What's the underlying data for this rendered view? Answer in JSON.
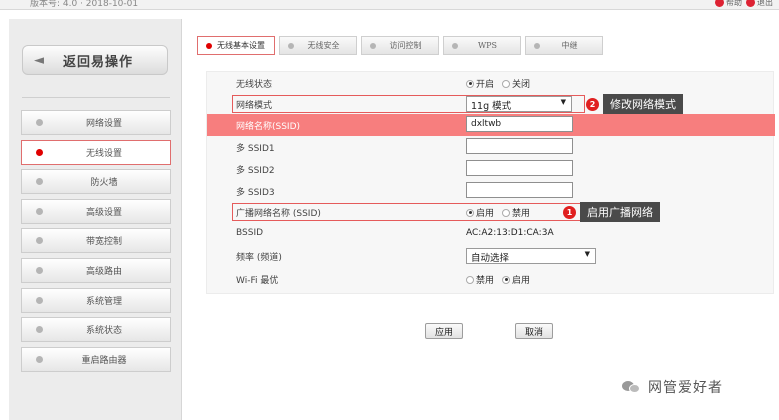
{
  "top": {
    "version": "版本号: 4.0 · 2018-10-01",
    "icons": [
      {
        "name": "help-icon",
        "label": "帮助"
      },
      {
        "name": "exit-icon",
        "label": "退出"
      }
    ]
  },
  "sidebar": {
    "back_label": "返回易操作",
    "items": [
      {
        "label": "网络设置",
        "active": false
      },
      {
        "label": "无线设置",
        "active": true
      },
      {
        "label": "防火墙",
        "active": false
      },
      {
        "label": "高级设置",
        "active": false
      },
      {
        "label": "带宽控制",
        "active": false
      },
      {
        "label": "高级路由",
        "active": false
      },
      {
        "label": "系统管理",
        "active": false
      },
      {
        "label": "系统状态",
        "active": false
      },
      {
        "label": "重启路由器",
        "active": false
      }
    ]
  },
  "tabs": [
    {
      "label": "无线基本设置",
      "active": true
    },
    {
      "label": "无线安全",
      "active": false
    },
    {
      "label": "访问控制",
      "active": false
    },
    {
      "label": "WPS",
      "active": false
    },
    {
      "label": "中继",
      "active": false
    }
  ],
  "form": {
    "wireless_status": {
      "label": "无线状态",
      "opt_on": "开启",
      "opt_off": "关闭",
      "selected": "开启"
    },
    "network_mode": {
      "label": "网络模式",
      "value": "11g 模式"
    },
    "ssid": {
      "label": "网络名称(SSID)",
      "value": "dxltwb"
    },
    "multi_ssid1": {
      "label": "多 SSID1",
      "value": ""
    },
    "multi_ssid2": {
      "label": "多 SSID2",
      "value": ""
    },
    "multi_ssid3": {
      "label": "多 SSID3",
      "value": ""
    },
    "broadcast_ssid": {
      "label": "广播网络名称 (SSID)",
      "opt_on": "启用",
      "opt_off": "禁用",
      "selected": "启用"
    },
    "bssid": {
      "label": "BSSID",
      "value": "AC:A2:13:D1:CA:3A"
    },
    "channel": {
      "label": "频率 (频道)",
      "value": "自动选择"
    },
    "wifi_optimize": {
      "label": "Wi-Fi 最优",
      "opt_off": "禁用",
      "opt_on": "启用",
      "selected": "启用"
    }
  },
  "callouts": [
    {
      "num": "2",
      "text": "修改网络模式"
    },
    {
      "num": "1",
      "text": "启用广播网络"
    }
  ],
  "buttons": {
    "apply": "应用",
    "cancel": "取消"
  },
  "watermark": "网管爱好者",
  "colors": {
    "accent_red": "#e00000",
    "highlight_row": "#f77e7e",
    "callout_bg": "#4a4a4a",
    "annot_box": "#e55b5b"
  }
}
